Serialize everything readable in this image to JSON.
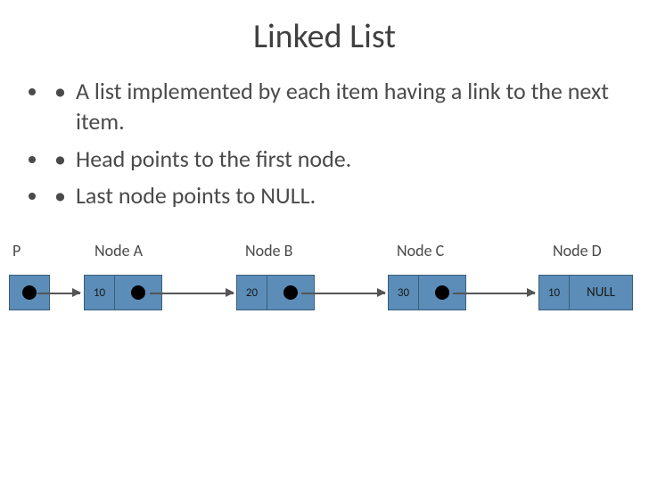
{
  "title": "Linked List",
  "bullets": [
    "A list implemented by each item having a link to the next item.",
    "Head points to the first node.",
    "Last node points to NULL."
  ],
  "labels": {
    "p": "P",
    "a": "Node A",
    "b": "Node B",
    "c": "Node C",
    "d": "Node D"
  },
  "nodes": {
    "a": "10",
    "b": "20",
    "c": "30",
    "d": "10",
    "terminal": "NULL"
  }
}
